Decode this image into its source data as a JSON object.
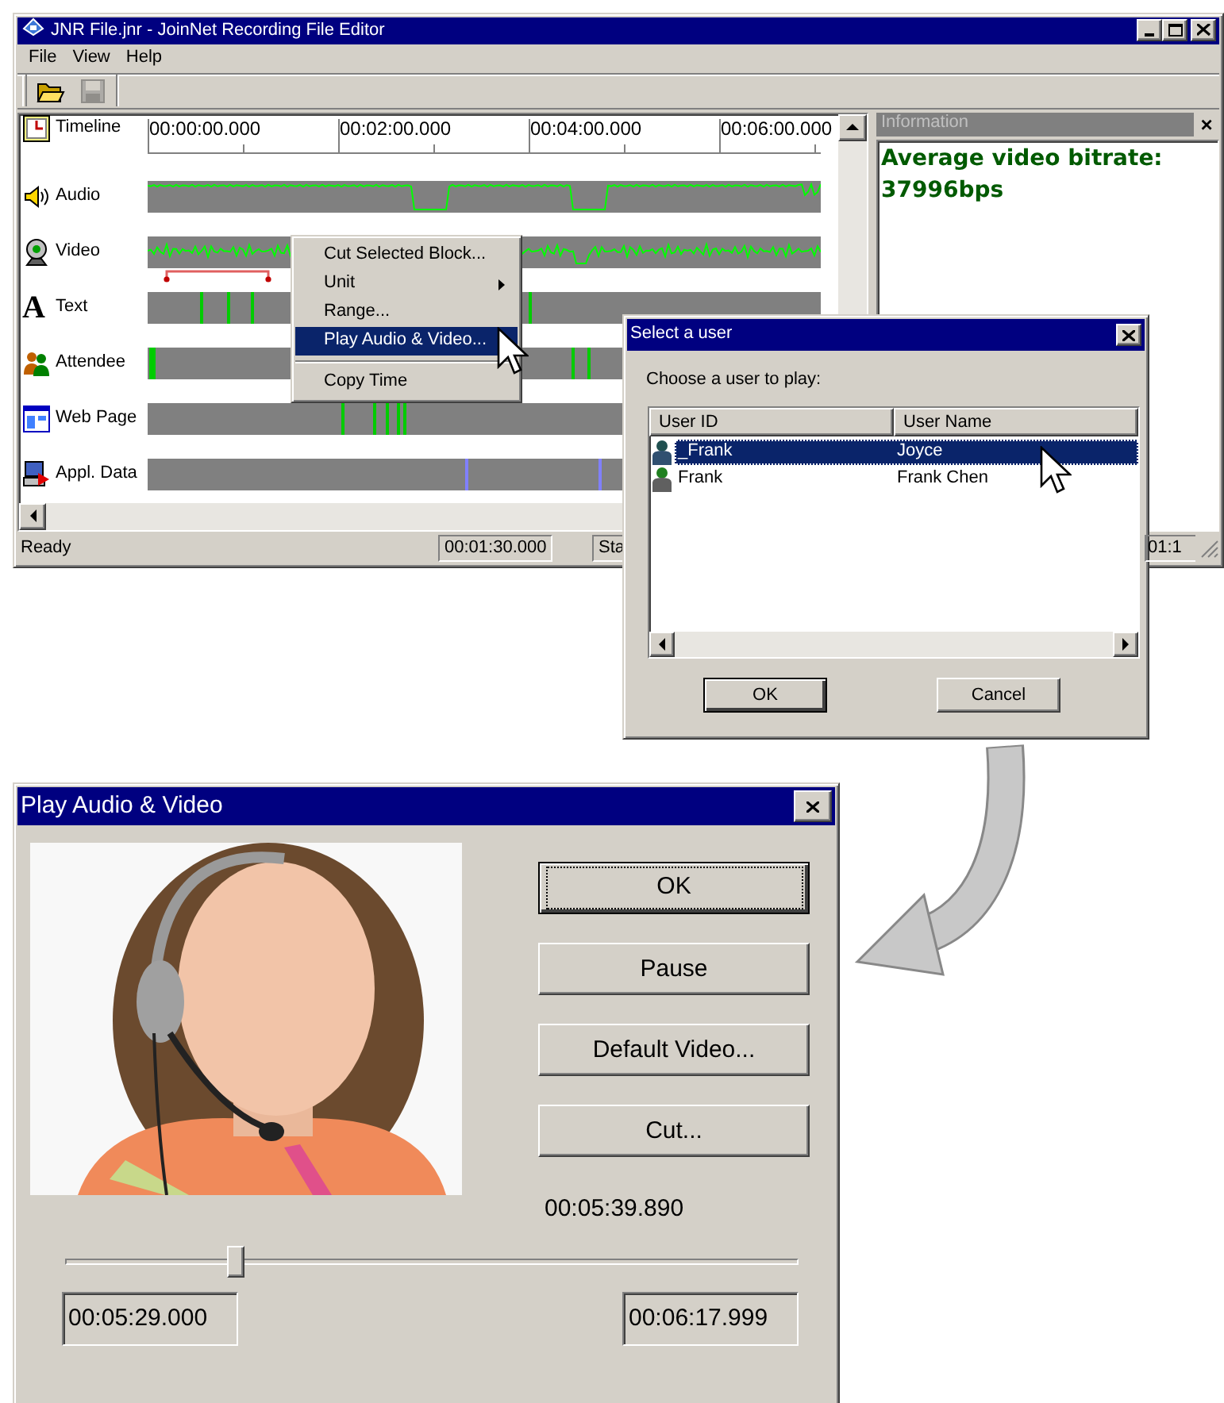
{
  "main_window": {
    "title": "JNR File.jnr - JoinNet Recording File Editor",
    "menu": [
      {
        "label": "File"
      },
      {
        "label": "View"
      },
      {
        "label": "Help"
      }
    ],
    "toolbar": [
      {
        "kind": "open",
        "disabled": false
      },
      {
        "kind": "save",
        "disabled": true
      }
    ],
    "tracks": [
      {
        "label": "Timeline",
        "kind": "ruler",
        "ticks": [
          "00:00:00.000",
          "00:02:00.000",
          "00:04:00.000",
          "00:06:00.000"
        ]
      },
      {
        "label": "Audio",
        "kind": "wave"
      },
      {
        "label": "Video",
        "kind": "wave"
      },
      {
        "glyph": "A",
        "label": "Text",
        "kind": "events",
        "color": "#00cc00"
      },
      {
        "label": "Attendee",
        "kind": "events",
        "color": "#00cc00"
      },
      {
        "label": "Web Page",
        "kind": "events",
        "color": "#00cc00"
      },
      {
        "label": "Appl. Data",
        "kind": "events",
        "color": "#8080ff"
      }
    ],
    "context_menu": [
      {
        "kind": "item",
        "label": "Cut Selected Block...",
        "selected": false
      },
      {
        "kind": "submenu",
        "label": "Unit",
        "selected": false
      },
      {
        "kind": "item",
        "label": "Range...",
        "selected": false
      },
      {
        "kind": "item",
        "label": "Play Audio & Video...",
        "selected": true
      },
      {
        "kind": "separator"
      },
      {
        "kind": "item",
        "label": "Copy Time",
        "selected": false
      }
    ],
    "information": {
      "title": "Information",
      "close": "×",
      "lines": [
        "Average video bitrate:",
        "37996bps"
      ]
    },
    "status_bar": [
      {
        "kind": "plain",
        "text": "Ready"
      },
      {
        "kind": "panel",
        "text": "00:01:30.000"
      },
      {
        "kind": "panel",
        "text": "Sta"
      },
      {
        "kind": "panel",
        "text": "01:1"
      }
    ]
  },
  "select_user_dialog": {
    "title": "Select a user",
    "prompt": "Choose a user to play:",
    "columns": [
      "User ID",
      "User Name"
    ],
    "rows": [
      {
        "user_id": "_Frank",
        "user_name": "Joyce",
        "selected": true
      },
      {
        "user_id": "Frank",
        "user_name": "Frank Chen",
        "selected": false
      }
    ],
    "buttons": [
      {
        "label": "OK",
        "default": true
      },
      {
        "label": "Cancel",
        "default": false
      }
    ]
  },
  "play_dialog": {
    "title": "Play Audio & Video",
    "buttons": [
      {
        "label": "OK",
        "default": true
      },
      {
        "label": "Pause",
        "default": false
      },
      {
        "label": "Default Video...",
        "default": false
      },
      {
        "label": "Cut...",
        "default": false
      }
    ],
    "current_time": "00:05:39.890",
    "slider": {
      "level": 0.23
    },
    "start_time": "00:05:29.000",
    "end_time": "00:06:17.999"
  }
}
